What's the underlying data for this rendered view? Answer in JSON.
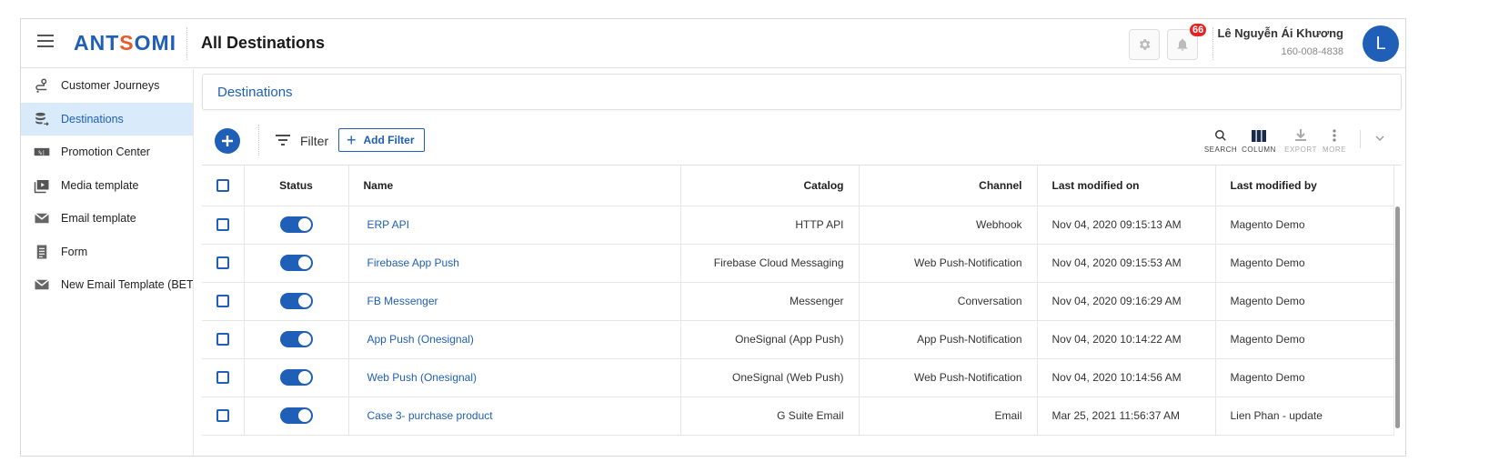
{
  "header": {
    "title": "All Destinations",
    "logo_text_a": "ANT",
    "logo_text_o": "S",
    "logo_text_b": "OMI",
    "notification_count": "66",
    "user_name": "Lê Nguyễn Ái Khương",
    "user_id": "160-008-4838",
    "avatar_letter": "L"
  },
  "sidebar": {
    "items": [
      {
        "label": "Customer Journeys",
        "icon": "journey-icon"
      },
      {
        "label": "Destinations",
        "icon": "destination-icon",
        "active": true
      },
      {
        "label": "Promotion Center",
        "icon": "promotion-icon"
      },
      {
        "label": "Media template",
        "icon": "media-icon"
      },
      {
        "label": "Email template",
        "icon": "email-icon"
      },
      {
        "label": "Form",
        "icon": "form-icon"
      },
      {
        "label": "New Email Template (BETA)",
        "icon": "email-icon"
      }
    ]
  },
  "main": {
    "section_title": "Destinations",
    "filter_label": "Filter",
    "add_filter_label": "Add Filter",
    "tools": {
      "search": "SEARCH",
      "column": "COLUMN",
      "export": "EXPORT",
      "more": "MORE"
    }
  },
  "table": {
    "headers": {
      "status": "Status",
      "name": "Name",
      "catalog": "Catalog",
      "channel": "Channel",
      "modified_on": "Last modified on",
      "modified_by": "Last modified by"
    },
    "rows": [
      {
        "name": "ERP API",
        "catalog": "HTTP API",
        "channel": "Webhook",
        "modified_on": "Nov 04, 2020 09:15:13 AM",
        "modified_by": "Magento Demo"
      },
      {
        "name": "Firebase App Push",
        "catalog": "Firebase Cloud Messaging",
        "channel": "Web Push-Notification",
        "modified_on": "Nov 04, 2020 09:15:53 AM",
        "modified_by": "Magento Demo"
      },
      {
        "name": "FB Messenger",
        "catalog": "Messenger",
        "channel": "Conversation",
        "modified_on": "Nov 04, 2020 09:16:29 AM",
        "modified_by": "Magento Demo"
      },
      {
        "name": "App Push (Onesignal)",
        "catalog": "OneSignal (App Push)",
        "channel": "App Push-Notification",
        "modified_on": "Nov 04, 2020 10:14:22 AM",
        "modified_by": "Magento Demo"
      },
      {
        "name": "Web Push (Onesignal)",
        "catalog": "OneSignal (Web Push)",
        "channel": "Web Push-Notification",
        "modified_on": "Nov 04, 2020 10:14:56 AM",
        "modified_by": "Magento Demo"
      },
      {
        "name": "Case 3- purchase product",
        "catalog": "G Suite Email",
        "channel": "Email",
        "modified_on": "Mar 25, 2021 11:56:37 AM",
        "modified_by": "Lien Phan - update"
      }
    ]
  },
  "colors": {
    "primary": "#1f5fb8",
    "accent": "#e85b2b",
    "badge": "#e32424",
    "active_bg": "#d9eafb"
  }
}
